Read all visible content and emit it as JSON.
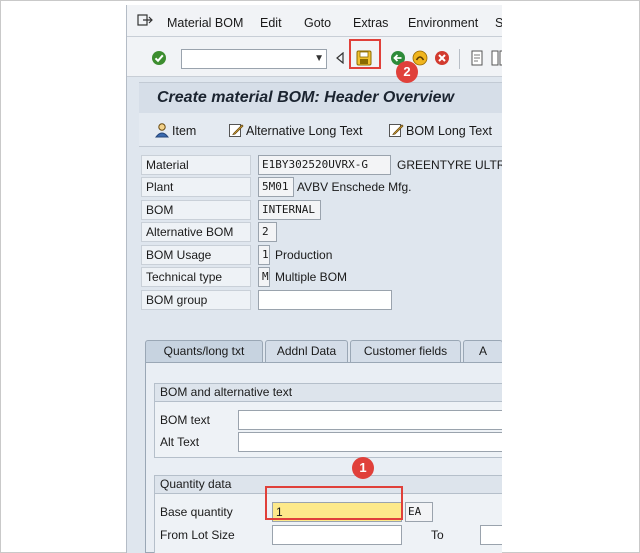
{
  "menu": {
    "items": [
      "Material BOM",
      "Edit",
      "Goto",
      "Extras",
      "Environment",
      "S"
    ]
  },
  "toolbar": {
    "command_value": ""
  },
  "callouts": {
    "save": "2",
    "base_quantity": "1"
  },
  "screen": {
    "title": "Create material BOM: Header Overview"
  },
  "app_toolbar": {
    "item": "Item",
    "alt_long_text": "Alternative Long Text",
    "bom_long_text": "BOM Long Text"
  },
  "header": {
    "material_label": "Material",
    "material_value": "E1BY302520UVRX-G",
    "material_desc": "GREENTYRE ULTR",
    "plant_label": "Plant",
    "plant_value": "5M01",
    "plant_desc": "AVBV Enschede Mfg.",
    "bom_label": "BOM",
    "bom_value": "INTERNAL",
    "alt_bom_label": "Alternative BOM",
    "alt_bom_value": "2",
    "bom_usage_label": "BOM Usage",
    "bom_usage_value": "1",
    "bom_usage_desc": "Production",
    "tech_type_label": "Technical type",
    "tech_type_value": "M",
    "tech_type_desc": "Multiple BOM",
    "bom_group_label": "BOM group",
    "bom_group_value": ""
  },
  "tabs": [
    "Quants/long txt",
    "Addnl Data",
    "Customer fields",
    "A"
  ],
  "bom_alt_text": {
    "heading": "BOM and alternative text",
    "bom_text_label": "BOM text",
    "alt_text_label": "Alt Text"
  },
  "quantity": {
    "heading": "Quantity data",
    "base_qty_label": "Base quantity",
    "base_qty_value": "1",
    "base_qty_unit": "EA",
    "from_lot_label": "From Lot Size",
    "to_label": "To"
  },
  "colors": {
    "callout": "#e0403a",
    "highlight_field": "#fde98a"
  }
}
